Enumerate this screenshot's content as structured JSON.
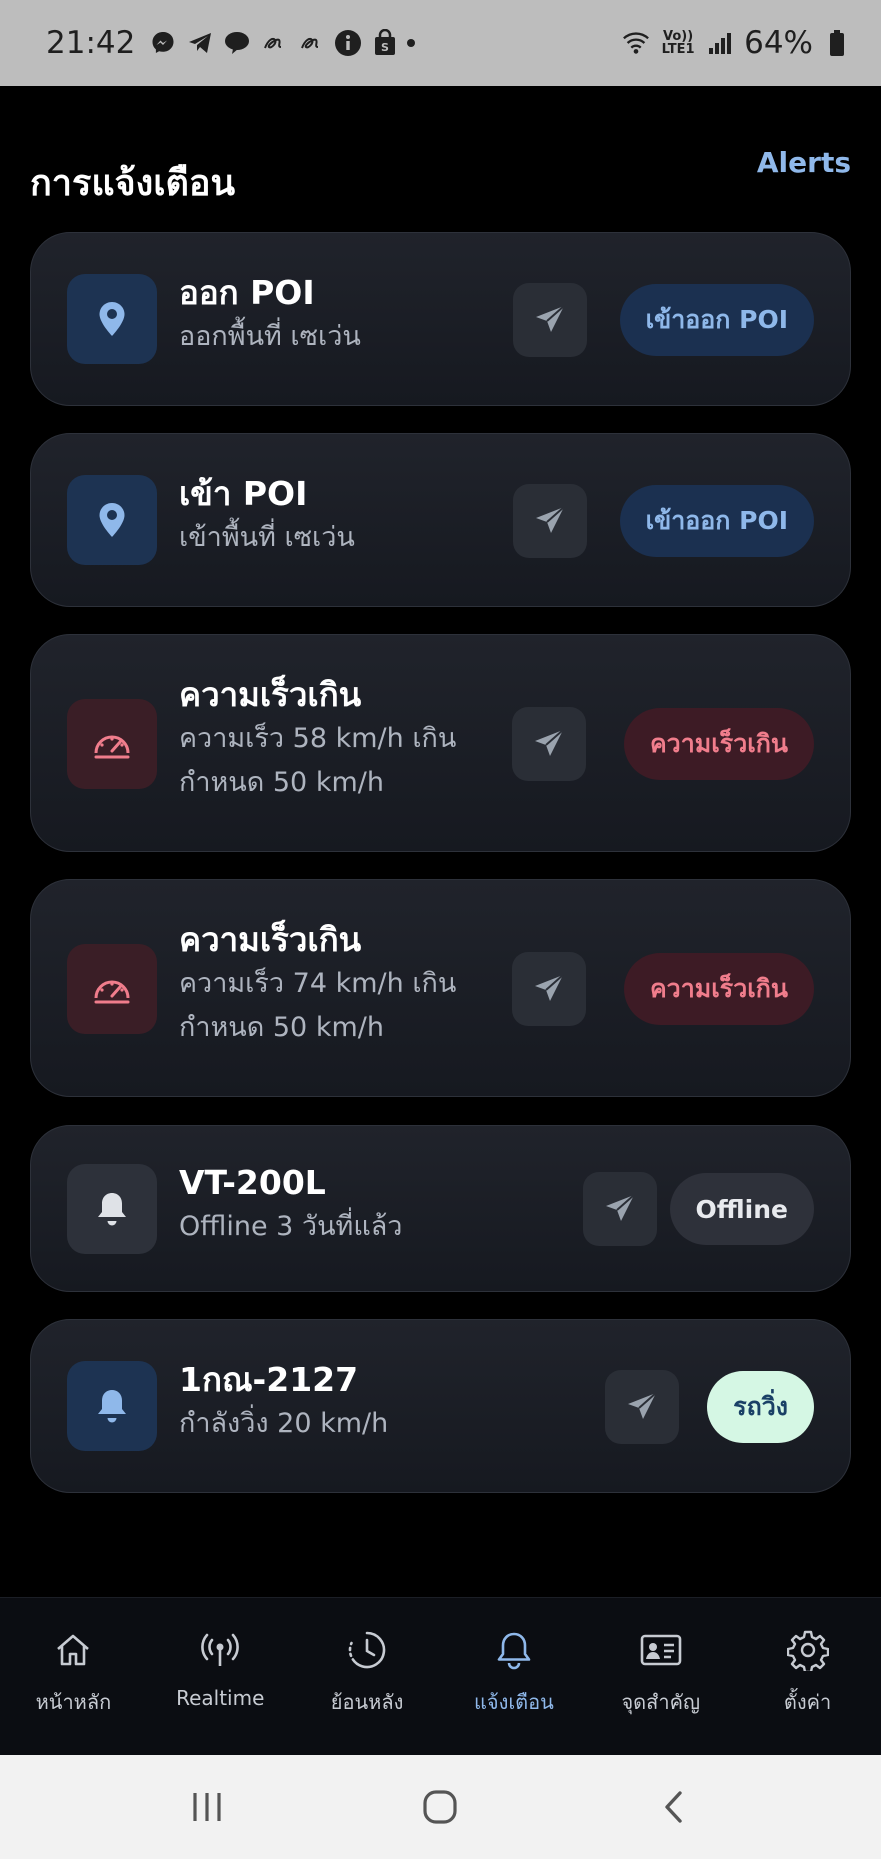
{
  "status_bar": {
    "time": "21:42",
    "network_label": "Vo)) LTE1",
    "battery": "64%"
  },
  "header": {
    "title": "การแจ้งเตือน",
    "link": "Alerts"
  },
  "alerts": [
    {
      "title": "ออก POI",
      "desc": [
        "ออกพื้นที่ เซเว่น"
      ],
      "badge": "เข้าออก POI",
      "icon": "location-pin-icon",
      "theme": "blue"
    },
    {
      "title": "เข้า POI",
      "desc": [
        "เข้าพื้นที่ เซเว่น"
      ],
      "badge": "เข้าออก POI",
      "icon": "location-pin-icon",
      "theme": "blue"
    },
    {
      "title": "ความเร็วเกิน",
      "desc": [
        "ความเร็ว 58 km/h เกิน",
        "กำหนด 50 km/h"
      ],
      "badge": "ความเร็วเกิน",
      "icon": "speedometer-icon",
      "theme": "red"
    },
    {
      "title": "ความเร็วเกิน",
      "desc": [
        "ความเร็ว 74 km/h เกิน",
        "กำหนด 50 km/h"
      ],
      "badge": "ความเร็วเกิน",
      "icon": "speedometer-icon",
      "theme": "red"
    },
    {
      "title": "VT-200L",
      "desc": [
        "Offline 3 วันที่แล้ว"
      ],
      "badge": "Offline",
      "icon": "bell-icon",
      "theme": "gray"
    },
    {
      "title": "1กณ-2127",
      "desc": [
        "กำลังวิ่ง 20 km/h"
      ],
      "badge": "รถวิ่ง",
      "icon": "bell-icon",
      "theme": "green"
    }
  ],
  "bottom_nav": [
    {
      "label": "หน้าหลัก",
      "icon": "home-icon",
      "active": false
    },
    {
      "label": "Realtime",
      "icon": "broadcast-icon",
      "active": false
    },
    {
      "label": "ย้อนหลัง",
      "icon": "history-clock-icon",
      "active": false
    },
    {
      "label": "แจ้งเตือน",
      "icon": "bell-icon",
      "active": true
    },
    {
      "label": "จุดสำคัญ",
      "icon": "id-card-icon",
      "active": false
    },
    {
      "label": "ตั้งค่า",
      "icon": "gear-icon",
      "active": false
    }
  ],
  "colors": {
    "accent": "#8fb8ea",
    "background": "#000000",
    "card": "#1b1e25",
    "danger": "#f07d8c",
    "success_bg": "#d5f7e4"
  }
}
